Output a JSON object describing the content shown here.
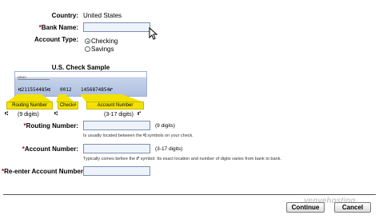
{
  "form": {
    "country_label": "Country:",
    "country_value": "United States",
    "bank_name_label": "Bank Name:",
    "account_type_label": "Account Type:",
    "account_type_options": [
      "Checking",
      "Savings"
    ],
    "routing_label": "Routing Number:",
    "routing_hint_digits": "(9 digits)",
    "routing_hint_prefix": "Is usually located between the",
    "routing_hint_suffix": "symbols on your check.",
    "account_label": "Account Number:",
    "account_hint_digits": "(3-17 digits)",
    "account_hint_prefix": "Typically comes before the",
    "account_hint_suffix": "symbol. Its exact location and number of digits varies from bank to bank.",
    "reenter_label": "Re-enter Account Number:",
    "required_marker": "*"
  },
  "check_sample": {
    "title": "U.S. Check Sample",
    "memo": "MEMO",
    "micr_routing": "⑆211554485⑆",
    "micr_check": "0012",
    "micr_account": "1456874854⑈",
    "tag_routing": "Routing Number",
    "tag_check": "Check#",
    "tag_account": "Account Number",
    "routing_sym_left": "⑆",
    "routing_digits": "(9 digits)",
    "routing_sym_right": "⑆",
    "account_digits": "(3-17 digits)",
    "account_sym": "⑈"
  },
  "footer": {
    "continue_label": "Continue",
    "cancel_label": "Cancel",
    "watermark": "venvehosting"
  },
  "colors": {
    "required": "#c00000",
    "input_bg": "#eef3fb",
    "tag_yellow": "#f2e200",
    "check_blue": "#aebfe0",
    "watermark": "#c9c9c9"
  }
}
